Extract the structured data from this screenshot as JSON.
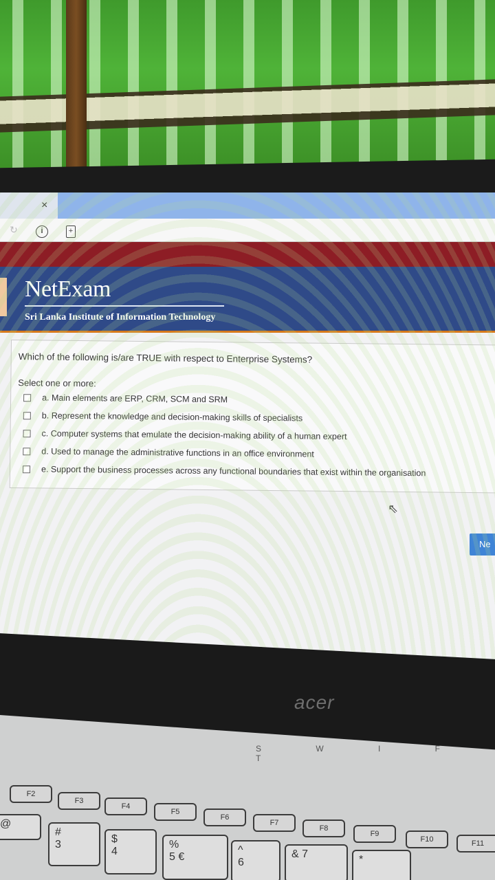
{
  "browser": {
    "tab_close": "×",
    "info_icon": "i",
    "pdf_icon": "+"
  },
  "header": {
    "brand": "NetExam",
    "institute": "Sri Lanka Institute of Information Technology"
  },
  "question": {
    "text": "Which of the following is/are TRUE with respect to Enterprise Systems?",
    "prompt": "Select one or more:",
    "options": [
      "a. Main elements are ERP, CRM, SCM and SRM",
      "b. Represent the knowledge and decision-making skills of specialists",
      "c. Computer systems that emulate the decision-making ability of a human expert",
      "d. Used to manage the administrative functions in an office environment",
      "e. Support the business processes across any functional boundaries that exist within the organisation"
    ]
  },
  "next_label": "Ne",
  "laptop": {
    "brand": "acer",
    "indicators": "S W I F T",
    "keys": [
      "#",
      "3",
      "$",
      "4",
      "%",
      "5",
      "€",
      "^",
      "6",
      "&",
      "7",
      "*",
      "@"
    ],
    "fn_keys": [
      "F2",
      "F3",
      "F4",
      "F5",
      "F6",
      "F7",
      "F8",
      "F9",
      "F10",
      "F11"
    ]
  }
}
